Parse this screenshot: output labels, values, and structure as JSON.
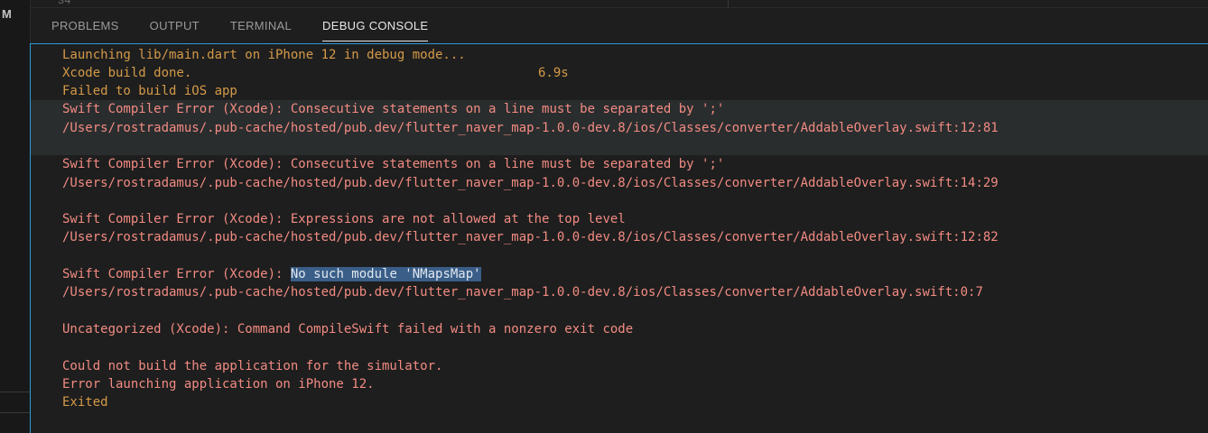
{
  "editor": {
    "line_number": "34"
  },
  "sidebar": {
    "mark": "M"
  },
  "panel": {
    "tabs": [
      {
        "label": "PROBLEMS",
        "active": false
      },
      {
        "label": "OUTPUT",
        "active": false
      },
      {
        "label": "TERMINAL",
        "active": false
      },
      {
        "label": "DEBUG CONSOLE",
        "active": true
      }
    ]
  },
  "console": {
    "colors": {
      "info": "#d49a48",
      "error": "#f28b82",
      "selection": "#3a5e88",
      "focus_border": "#2b9bd6"
    },
    "lines": [
      {
        "text": "Launching lib/main.dart on iPhone 12 in debug mode..."
      },
      {
        "text": "Xcode build done.",
        "time": "6.9s"
      },
      {
        "text": "Failed to build iOS app"
      },
      {
        "text": "Swift Compiler Error (Xcode): Consecutive statements on a line must be separated by ';'"
      },
      {
        "text": "/Users/rostradamus/.pub-cache/hosted/pub.dev/flutter_naver_map-1.0.0-dev.8/ios/Classes/converter/AddableOverlay.swift:12:81"
      },
      {
        "text": ""
      },
      {
        "text": "Swift Compiler Error (Xcode): Consecutive statements on a line must be separated by ';'"
      },
      {
        "text": "/Users/rostradamus/.pub-cache/hosted/pub.dev/flutter_naver_map-1.0.0-dev.8/ios/Classes/converter/AddableOverlay.swift:14:29"
      },
      {
        "text": ""
      },
      {
        "text": "Swift Compiler Error (Xcode): Expressions are not allowed at the top level"
      },
      {
        "text": "/Users/rostradamus/.pub-cache/hosted/pub.dev/flutter_naver_map-1.0.0-dev.8/ios/Classes/converter/AddableOverlay.swift:12:82"
      },
      {
        "text": ""
      },
      {
        "prefix": "Swift Compiler Error (Xcode): ",
        "selected": "No such module 'NMapsMap'"
      },
      {
        "text": "/Users/rostradamus/.pub-cache/hosted/pub.dev/flutter_naver_map-1.0.0-dev.8/ios/Classes/converter/AddableOverlay.swift:0:7"
      },
      {
        "text": ""
      },
      {
        "text": "Uncategorized (Xcode): Command CompileSwift failed with a nonzero exit code"
      },
      {
        "text": ""
      },
      {
        "text": "Could not build the application for the simulator."
      },
      {
        "text": "Error launching application on iPhone 12."
      },
      {
        "text": "Exited"
      }
    ]
  }
}
